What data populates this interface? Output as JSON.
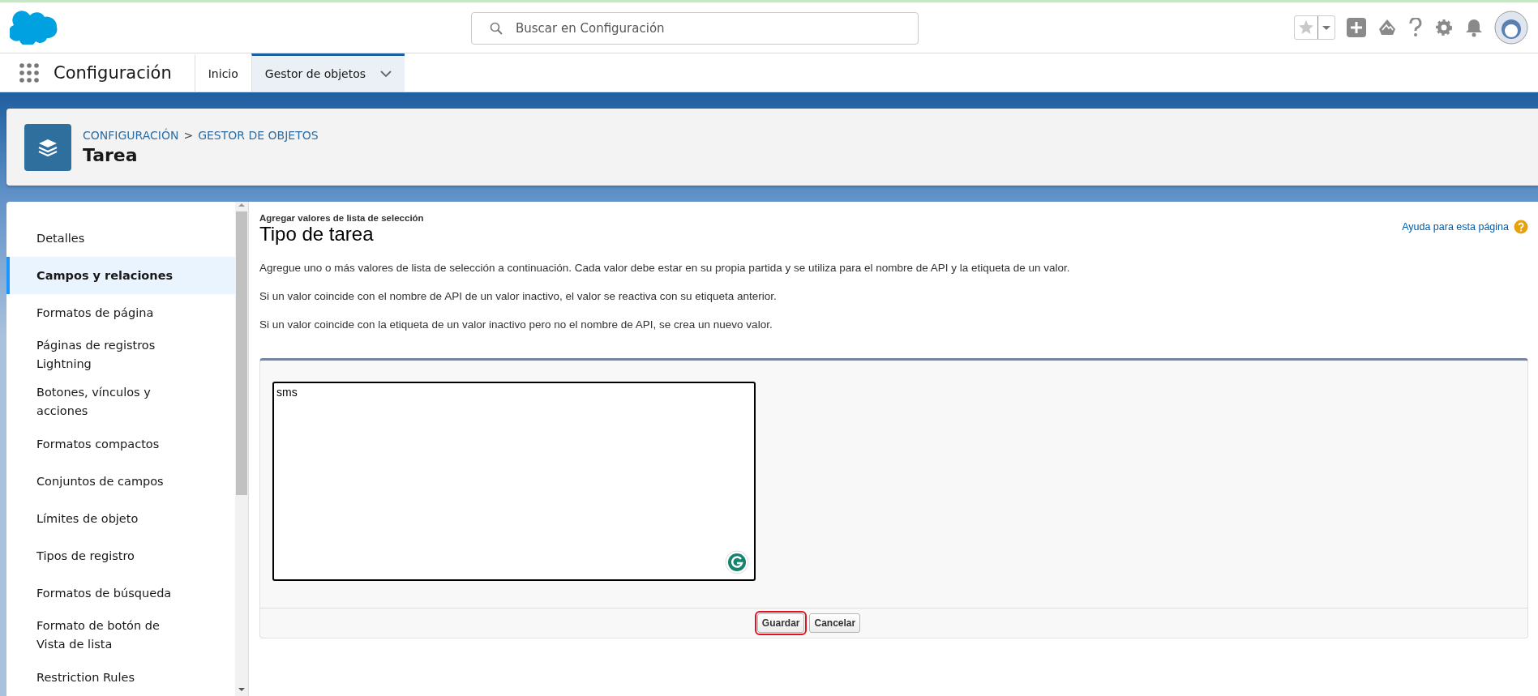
{
  "header": {
    "search": {
      "placeholder": "Buscar en Configuración"
    }
  },
  "nav": {
    "app_name": "Configuración",
    "tabs": [
      {
        "label": "Inicio",
        "selected": false,
        "has_menu": false
      },
      {
        "label": "Gestor de objetos",
        "selected": true,
        "has_menu": true
      }
    ]
  },
  "page_header": {
    "breadcrumbs": [
      "CONFIGURACIÓN",
      "GESTOR DE OBJETOS"
    ],
    "separator": ">",
    "title": "Tarea"
  },
  "sidebar": {
    "items": [
      {
        "label": "Detalles",
        "selected": false
      },
      {
        "label": "Campos y relaciones",
        "selected": true
      },
      {
        "label": "Formatos de página",
        "selected": false
      },
      {
        "label": "Páginas de registros Lightning",
        "selected": false
      },
      {
        "label": "Botones, vínculos y acciones",
        "selected": false
      },
      {
        "label": "Formatos compactos",
        "selected": false
      },
      {
        "label": "Conjuntos de campos",
        "selected": false
      },
      {
        "label": "Límites de objeto",
        "selected": false
      },
      {
        "label": "Tipos de registro",
        "selected": false
      },
      {
        "label": "Formatos de búsqueda",
        "selected": false
      },
      {
        "label": "Formato de botón de Vista de lista",
        "selected": false
      },
      {
        "label": "Restriction Rules",
        "selected": false
      }
    ]
  },
  "content": {
    "subtitle": "Agregar valores de lista de selección",
    "title": "Tipo de tarea",
    "help_link": "Ayuda para esta página",
    "paragraphs": [
      "Agregue uno o más valores de lista de selección a continuación. Cada valor debe estar en su propia partida y se utiliza para el nombre de API y la etiqueta de un valor.",
      "Si un valor coincide con el nombre de API de un valor inactivo, el valor se reactiva con su etiqueta anterior.",
      "Si un valor coincide con la etiqueta de un valor inactivo pero no el nombre de API, se crea un nuevo valor."
    ],
    "values_field": {
      "value": "sms"
    },
    "buttons": [
      {
        "label": "Guardar",
        "highlighted": true
      },
      {
        "label": "Cancelar",
        "highlighted": false
      }
    ]
  }
}
